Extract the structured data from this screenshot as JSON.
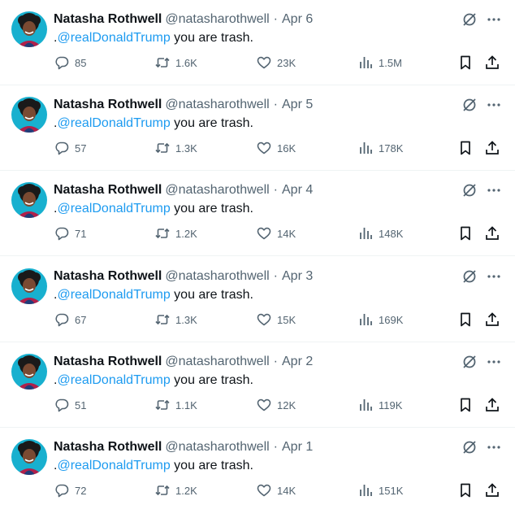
{
  "tweets": [
    {
      "name": "Natasha Rothwell",
      "handle": "@natasharothwell",
      "dot": "·",
      "date": "Apr 6",
      "prefix": ".",
      "mention": "@realDonaldTrump",
      "text": " you are trash.",
      "replies": "85",
      "reposts": "1.6K",
      "likes": "23K",
      "views": "1.5M"
    },
    {
      "name": "Natasha Rothwell",
      "handle": "@natasharothwell",
      "dot": "·",
      "date": "Apr 5",
      "prefix": ".",
      "mention": "@realDonaldTrump",
      "text": " you are trash.",
      "replies": "57",
      "reposts": "1.3K",
      "likes": "16K",
      "views": "178K"
    },
    {
      "name": "Natasha Rothwell",
      "handle": "@natasharothwell",
      "dot": "·",
      "date": "Apr 4",
      "prefix": ".",
      "mention": "@realDonaldTrump",
      "text": " you are trash.",
      "replies": "71",
      "reposts": "1.2K",
      "likes": "14K",
      "views": "148K"
    },
    {
      "name": "Natasha Rothwell",
      "handle": "@natasharothwell",
      "dot": "·",
      "date": "Apr 3",
      "prefix": ".",
      "mention": "@realDonaldTrump",
      "text": " you are trash.",
      "replies": "67",
      "reposts": "1.3K",
      "likes": "15K",
      "views": "169K"
    },
    {
      "name": "Natasha Rothwell",
      "handle": "@natasharothwell",
      "dot": "·",
      "date": "Apr 2",
      "prefix": ".",
      "mention": "@realDonaldTrump",
      "text": " you are trash.",
      "replies": "51",
      "reposts": "1.1K",
      "likes": "12K",
      "views": "119K"
    },
    {
      "name": "Natasha Rothwell",
      "handle": "@natasharothwell",
      "dot": "·",
      "date": "Apr 1",
      "prefix": ".",
      "mention": "@realDonaldTrump",
      "text": " you are trash.",
      "replies": "72",
      "reposts": "1.2K",
      "likes": "14K",
      "views": "151K"
    }
  ],
  "icons": {
    "reply": "reply-icon",
    "repost": "repost-icon",
    "like": "like-icon",
    "views": "views-icon",
    "bookmark": "bookmark-icon",
    "share": "share-icon",
    "grok": "grok-icon",
    "more": "more-icon"
  },
  "colors": {
    "text": "#0f1419",
    "secondary": "#536471",
    "mention": "#1d9bf0",
    "divider": "#eff3f4",
    "avatar_bg": "#18b0cf"
  }
}
